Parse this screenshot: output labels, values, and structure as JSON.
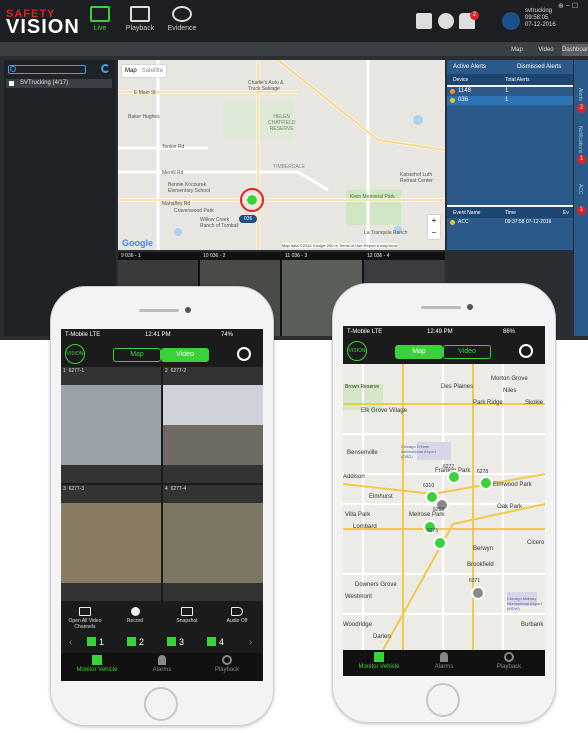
{
  "desktop": {
    "logo_top": "SAFETY",
    "logo_main": "VISION",
    "nav": [
      {
        "label": "Live"
      },
      {
        "label": "Playback"
      },
      {
        "label": "Evidence"
      }
    ],
    "notification_count": "2",
    "user": {
      "name": "svtrucking",
      "time": "09:58:05",
      "date": "07-12-2016"
    },
    "view_tabs": [
      "Map",
      "Video",
      "Dashboard"
    ],
    "tree": {
      "search_placeholder": "",
      "root_item": "SVTrucking (4/17)"
    },
    "map": {
      "tabs": [
        "Map",
        "Satellite"
      ],
      "labels": [
        "Charlie's Auto &",
        "Truck Salvage",
        "E Main St",
        "Baker Hughes",
        "HELEN",
        "CHATFIELD",
        "RESERVE",
        "Tonkin Rd",
        "Merrill Rd",
        "Bennie Kocourek",
        "Elementary School",
        "Mahaffey Rd",
        "Cravenwood Park",
        "Willow Creek",
        "Ranch of Tomball",
        "TIMBERDALE",
        "Klein Memorial Park",
        "Kaiserhof Luth",
        "Retreat Center",
        "La Tranquila Ranch",
        "Google",
        "Map data ©2016 Google",
        "200 m",
        "Terms of Use",
        "Report a map error"
      ],
      "marker_label": "036",
      "zoom_in": "+",
      "zoom_out": "−"
    },
    "alerts": {
      "tabs": [
        "Active Alerts",
        "Dismissed Alerts"
      ],
      "columns": [
        "Device",
        "Total Alerts"
      ],
      "rows": [
        {
          "device": "1148",
          "total": "1"
        },
        {
          "device": "036",
          "total": "1"
        }
      ],
      "event_columns": [
        "Event Name",
        "Time",
        "Ev"
      ],
      "events": [
        {
          "name": "ACC",
          "time": "09:37:58 07-12-2016"
        }
      ]
    },
    "rail_badges": [
      "2",
      "1",
      "1"
    ],
    "rail_labels": [
      "Alerts",
      "Notifications",
      "ACC"
    ],
    "cameras": [
      "9 036 - 1",
      "10 036 - 2",
      "11 036 - 3",
      "12 036 - 4"
    ]
  },
  "phone_left": {
    "carrier": "T-Mobile",
    "network": "LTE",
    "time": "12:41 PM",
    "battery": "74%",
    "logo": "VISION",
    "segments": [
      "Map",
      "Video"
    ],
    "tiles": [
      {
        "num": "1",
        "id": "6277-1"
      },
      {
        "num": "2",
        "id": "6277-2"
      },
      {
        "num": "3",
        "id": "6277-3"
      },
      {
        "num": "4",
        "id": "6277-4"
      }
    ],
    "controls": [
      "Open All Video Channels",
      "Record",
      "Snapshot",
      "Audio Off"
    ],
    "channels": [
      "1",
      "2",
      "3",
      "4"
    ],
    "tabs": [
      "Monitor Vehicle",
      "Alarms",
      "Playback"
    ]
  },
  "phone_right": {
    "carrier": "T-Mobile",
    "network": "LTE",
    "time": "12:49 PM",
    "battery": "86%",
    "logo": "VISION",
    "segments": [
      "Map",
      "Video"
    ],
    "map_labels": [
      "Morton Grove",
      "Des Plaines",
      "Niles",
      "Park Ridge",
      "Skokie",
      "Elk Grove Village",
      "Bensenville",
      "Chicago O'Hare International Airport (ORD)",
      "Addison",
      "Franklin Park",
      "Elmhurst",
      "Melrose Park",
      "Villa Park",
      "Lombard",
      "Oak Park",
      "Berwyn",
      "Brookfield",
      "Cicero",
      "Downers Grove",
      "Westmont",
      "Woodridge",
      "Darien",
      "Burbank",
      "Chicago Midway International Airport (MDW)",
      "Elmwood Park",
      "Bloomingdale",
      "Brown Reserve"
    ],
    "pins": [
      "6277",
      "6278",
      "6310",
      "6263",
      "6275",
      "6271"
    ],
    "tabs": [
      "Monitor Vehicle",
      "Alarms",
      "Playback"
    ]
  }
}
